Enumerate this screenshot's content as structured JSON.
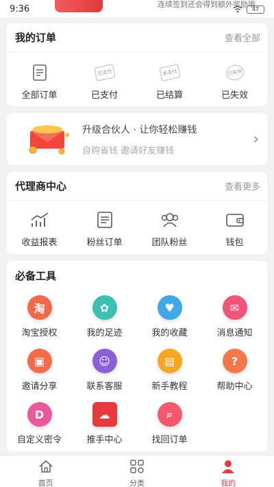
{
  "status_bar": {
    "time": "9:36",
    "marquee": "连续签到还会得到额外奖励哦",
    "battery": "47"
  },
  "orders": {
    "title": "我的订单",
    "more": "查看全部",
    "items": [
      {
        "label": "全部订单",
        "icon": "document-list-icon"
      },
      {
        "label": "已支付",
        "icon": "paid-stamp-icon"
      },
      {
        "label": "已结算",
        "icon": "settled-stamp-icon"
      },
      {
        "label": "已失效",
        "icon": "expired-stamp-icon"
      }
    ]
  },
  "promo": {
    "title": "升级合伙人 · 让你轻松赚钱",
    "subtitle": "自购省钱 邀请好友赚钱"
  },
  "agent": {
    "title": "代理商中心",
    "more": "查看更多",
    "items": [
      {
        "label": "收益报表",
        "icon": "chart-trend-icon"
      },
      {
        "label": "粉丝订单",
        "icon": "clipboard-icon"
      },
      {
        "label": "团队粉丝",
        "icon": "team-icon"
      },
      {
        "label": "钱包",
        "icon": "wallet-icon"
      }
    ]
  },
  "tools": {
    "title": "必备工具",
    "items": [
      {
        "label": "淘宝授权",
        "icon": "taobao-icon",
        "color": "#f06a4a",
        "glyph": "淘"
      },
      {
        "label": "我的足迹",
        "icon": "footprint-icon",
        "color": "#3bbfb3",
        "glyph": "✿"
      },
      {
        "label": "我的收藏",
        "icon": "favorite-icon",
        "color": "#41a8e8",
        "glyph": "♥"
      },
      {
        "label": "消息通知",
        "icon": "message-icon",
        "color": "#f2557a",
        "glyph": "✉"
      },
      {
        "label": "邀请分享",
        "icon": "gift-icon",
        "color": "#f26b4b",
        "glyph": "▣"
      },
      {
        "label": "联系客服",
        "icon": "customer-service-icon",
        "color": "#8b5fd6",
        "glyph": "☺"
      },
      {
        "label": "新手教程",
        "icon": "tutorial-icon",
        "color": "#f6a623",
        "glyph": "▤"
      },
      {
        "label": "帮助中心",
        "icon": "help-icon",
        "color": "#f2774a",
        "glyph": "?"
      },
      {
        "label": "自定义密令",
        "icon": "password-icon",
        "color": "#e85a9c",
        "glyph": "D"
      },
      {
        "label": "推手中心",
        "icon": "cloud-push-icon",
        "color": "#e8393f",
        "glyph": "☁"
      },
      {
        "label": "找回订单",
        "icon": "search-order-icon",
        "color": "#f4596b",
        "glyph": "⌕"
      }
    ]
  },
  "tabbar": {
    "items": [
      {
        "label": "首页",
        "icon": "home-icon"
      },
      {
        "label": "分类",
        "icon": "category-icon"
      },
      {
        "label": "我的",
        "icon": "user-icon"
      }
    ],
    "active_color": "#e8393f"
  }
}
